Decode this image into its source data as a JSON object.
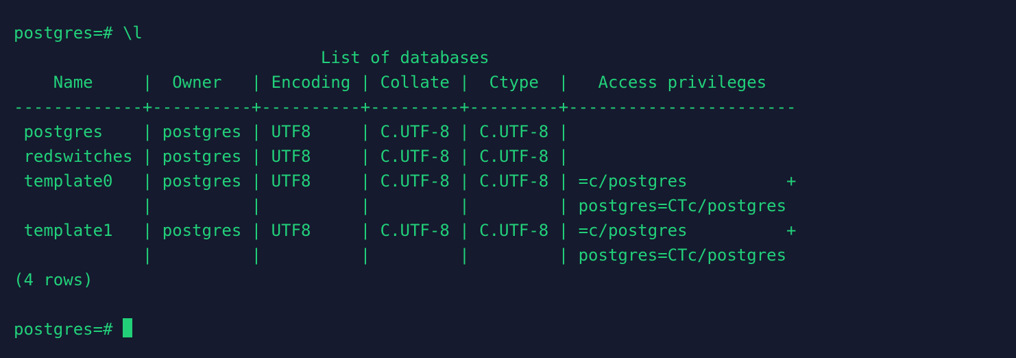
{
  "prompt": "postgres=#",
  "command": "\\l",
  "title": "List of databases",
  "columns": [
    "Name",
    "Owner",
    "Encoding",
    "Collate",
    "Ctype",
    "Access privileges"
  ],
  "rows": [
    {
      "name": "postgres",
      "owner": "postgres",
      "encoding": "UTF8",
      "collate": "C.UTF-8",
      "ctype": "C.UTF-8",
      "priv": [
        ""
      ]
    },
    {
      "name": "redswitches",
      "owner": "postgres",
      "encoding": "UTF8",
      "collate": "C.UTF-8",
      "ctype": "C.UTF-8",
      "priv": [
        ""
      ]
    },
    {
      "name": "template0",
      "owner": "postgres",
      "encoding": "UTF8",
      "collate": "C.UTF-8",
      "ctype": "C.UTF-8",
      "priv": [
        "=c/postgres",
        "postgres=CTc/postgres"
      ]
    },
    {
      "name": "template1",
      "owner": "postgres",
      "encoding": "UTF8",
      "collate": "C.UTF-8",
      "ctype": "C.UTF-8",
      "priv": [
        "=c/postgres",
        "postgres=CTc/postgres"
      ]
    }
  ],
  "row_count_text": "(4 rows)",
  "widths": {
    "name": 13,
    "owner": 10,
    "encoding": 10,
    "collate": 9,
    "ctype": 9,
    "priv": 23
  }
}
